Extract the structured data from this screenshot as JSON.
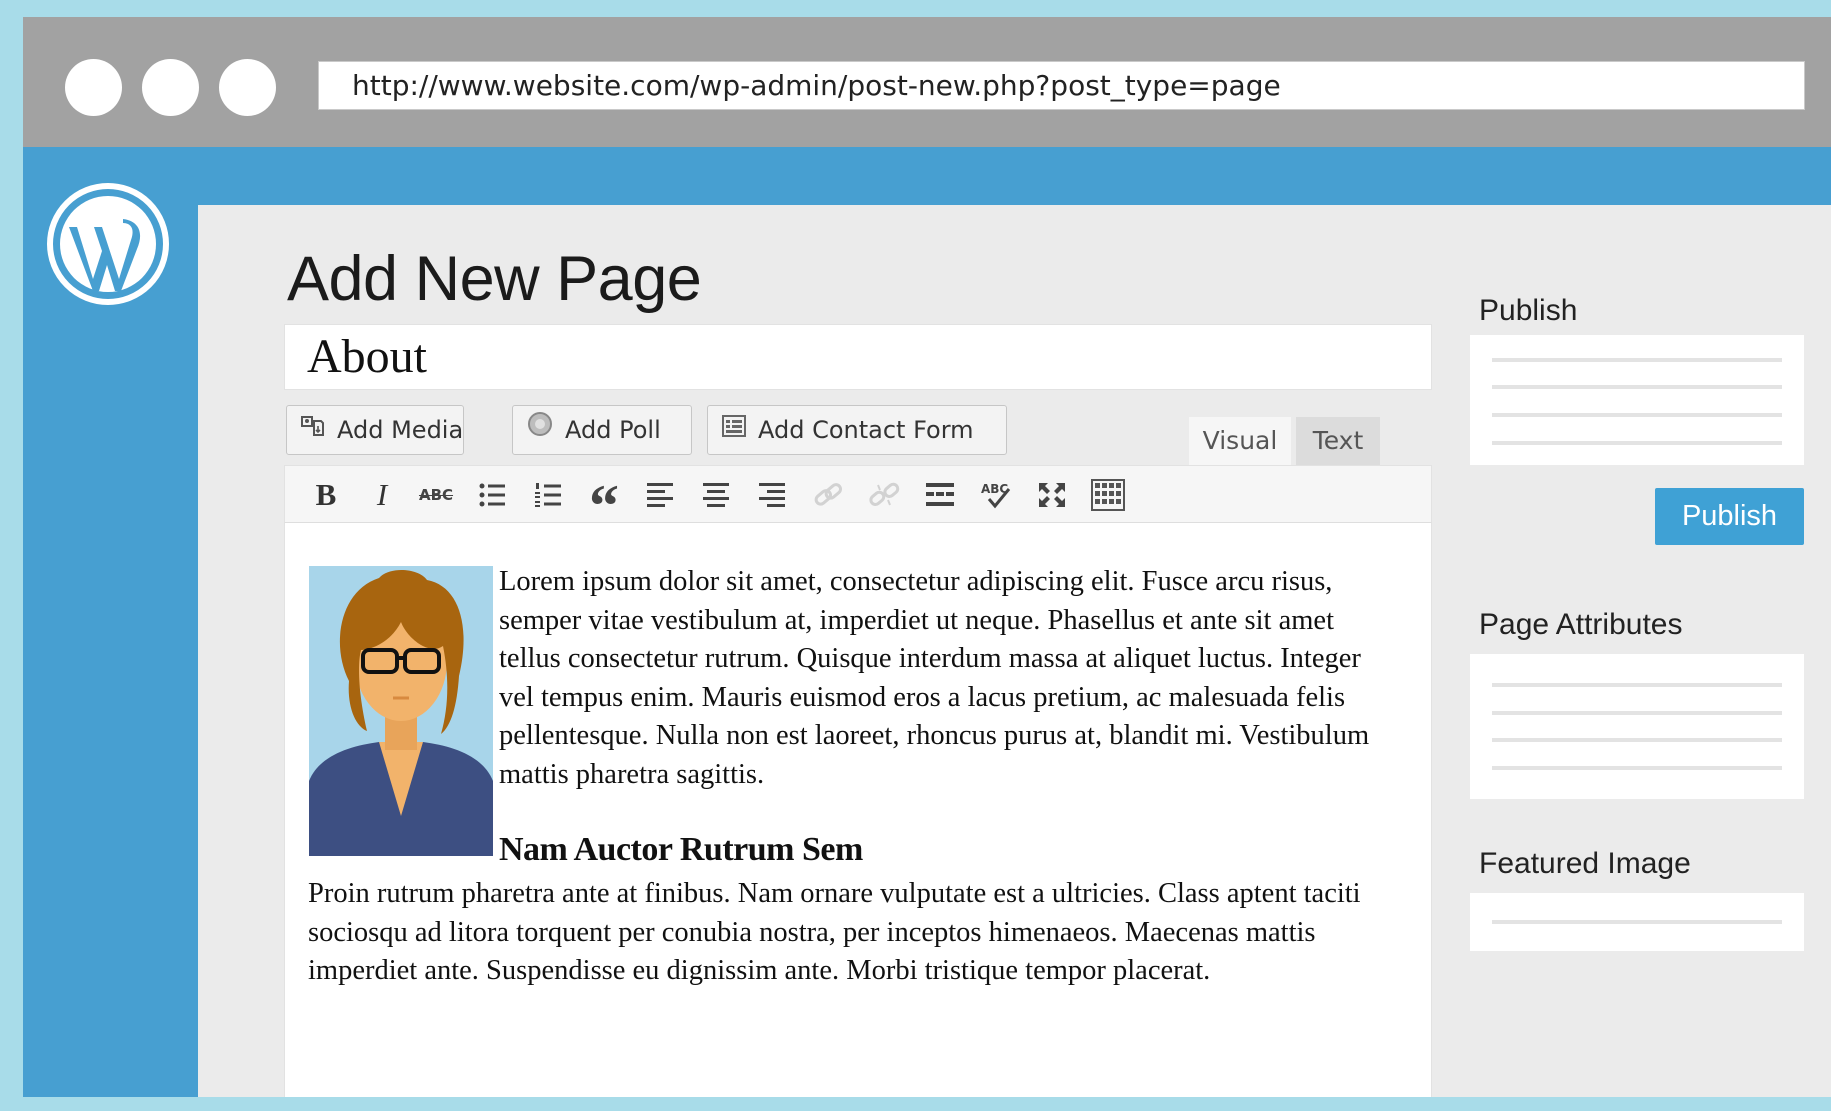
{
  "browser": {
    "url": "http://www.website.com/wp-admin/post-new.php?post_type=page"
  },
  "colors": {
    "admin_bar": "#479fd1",
    "publish_button": "#3fa1d5",
    "page_background": "#a8dce9"
  },
  "page": {
    "title": "Add New Page",
    "post_title": "About"
  },
  "media_buttons": {
    "add_media": "Add Media",
    "add_poll": "Add Poll",
    "add_contact_form": "Add Contact Form"
  },
  "editor_tabs": {
    "visual": "Visual",
    "text": "Text"
  },
  "toolbar_icons": [
    "bold-icon",
    "italic-icon",
    "strikethrough-icon",
    "bulleted-list-icon",
    "numbered-list-icon",
    "blockquote-icon",
    "align-left-icon",
    "align-center-icon",
    "align-right-icon",
    "insert-link-icon",
    "remove-link-icon",
    "read-more-icon",
    "spellcheck-icon",
    "fullscreen-icon",
    "toolbar-toggle-icon"
  ],
  "toolbar_glyphs": {
    "bold": "B",
    "italic": "I",
    "strikethrough": "ABC",
    "blockquote": "“"
  },
  "content": {
    "paragraph1": "Lorem ipsum dolor sit amet, consectetur adipiscing elit. Fusce arcu risus, semper vitae vestibulum at, imperdiet ut neque. Phasellus et ante sit amet tellus consectetur rutrum. Quisque interdum massa at aliquet luctus. Integer vel tempus enim. Mauris euismod eros a lacus pretium, ac malesuada felis pellentesque. Nulla non est laoreet, rhoncus purus at, blandit mi. Vestibulum mattis pharetra sagittis.",
    "heading": "Nam Auctor Rutrum Sem",
    "paragraph2": "Proin rutrum pharetra ante at finibus. Nam ornare vulputate est a ultricies. Class aptent taciti sociosqu ad litora torquent per conubia nostra, per inceptos himenaeos. Maecenas mattis imperdiet ante. Suspendisse eu dignissim ante. Morbi tristique tempor placerat."
  },
  "sidebar_panels": {
    "publish_label": "Publish",
    "publish_button": "Publish",
    "page_attributes_label": "Page Attributes",
    "featured_image_label": "Featured Image"
  }
}
